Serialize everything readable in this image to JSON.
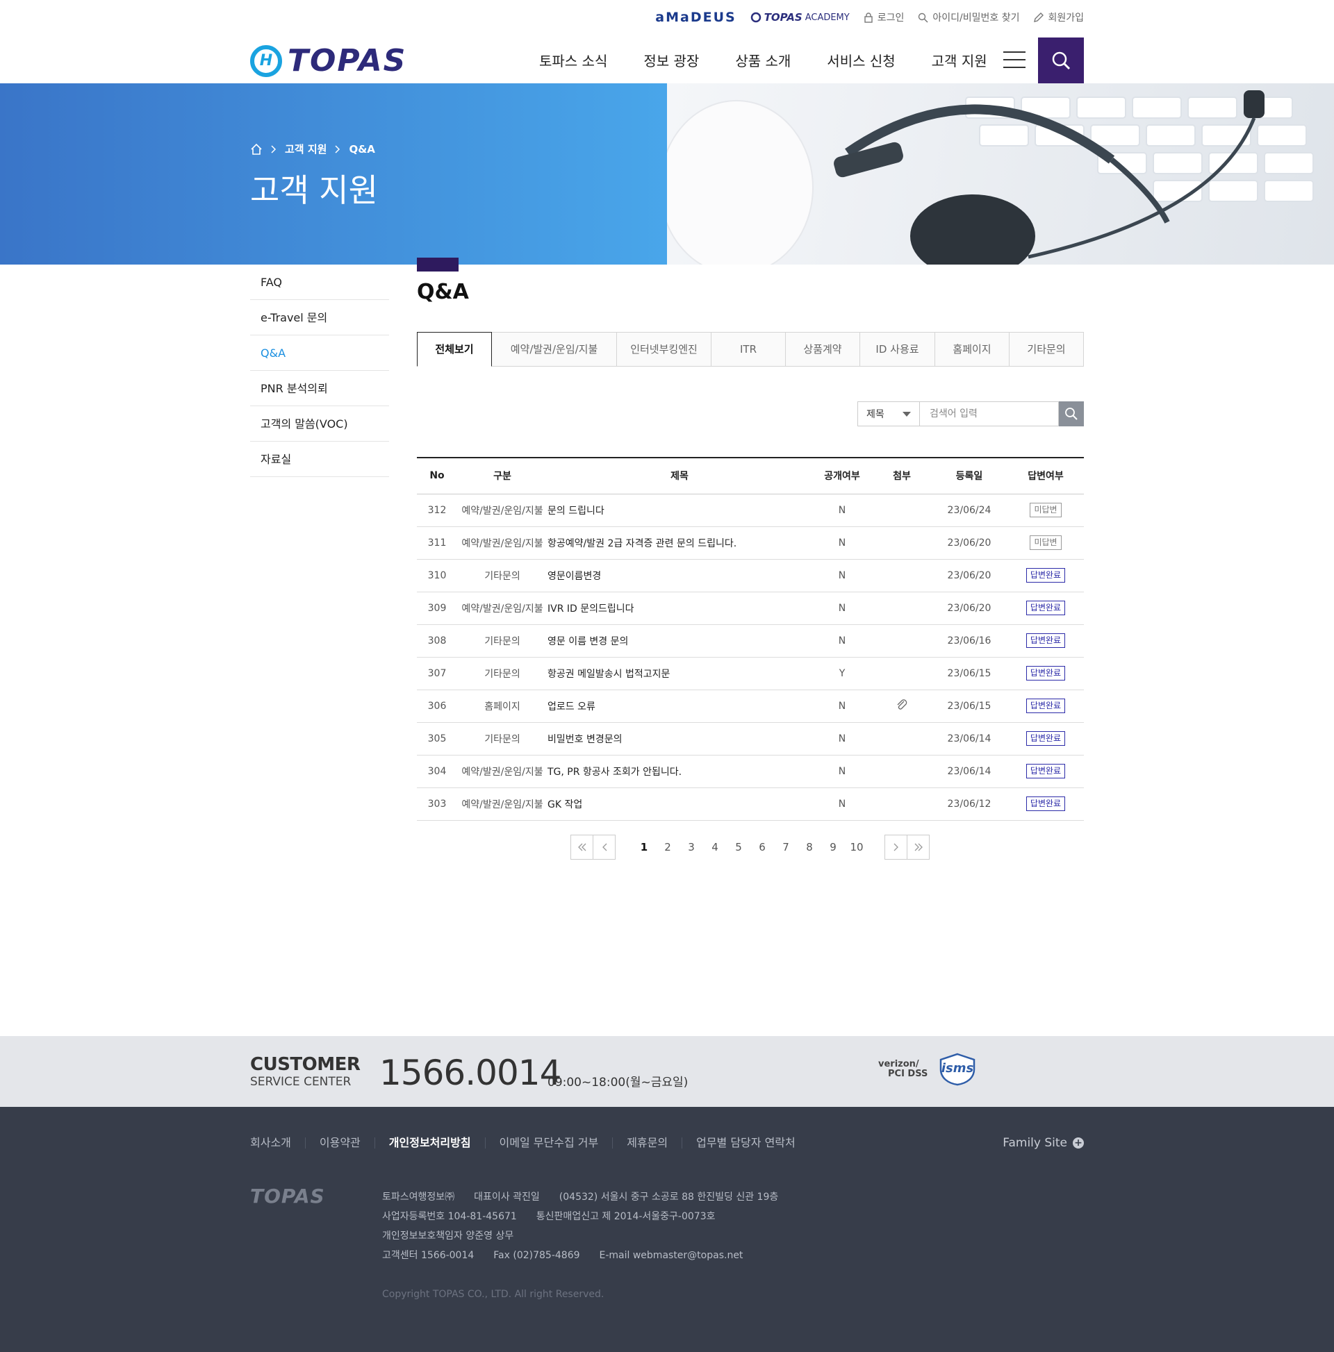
{
  "util": {
    "amadeus": "aMaDEUS",
    "academy_topas": "TOPAS",
    "academy_label": "ACADEMY",
    "login": "로그인",
    "find": "아이디/비밀번호 찾기",
    "join": "회원가입"
  },
  "logo": {
    "mark": "H",
    "word": "TOPAS"
  },
  "gnb": [
    "토파스 소식",
    "정보 광장",
    "상품 소개",
    "서비스 신청",
    "고객 지원"
  ],
  "hero": {
    "crumb1": "고객 지원",
    "crumb2": "Q&A",
    "title": "고객 지원",
    "left_color": "#3a75c8",
    "right_color": "#49a6ea"
  },
  "lnb": [
    "FAQ",
    "e-Travel 문의",
    "Q&A",
    "PNR 분석의뢰",
    "고객의 말씀(VOC)",
    "자료실"
  ],
  "lnb_active": 2,
  "page_title": "Q&A",
  "tabs": [
    "전체보기",
    "예약/발권/운임/지불",
    "인터넷부킹엔진",
    "ITR",
    "상품계약",
    "ID 사용료",
    "홈페이지",
    "기타문의"
  ],
  "search": {
    "field": "제목",
    "placeholder": "검색어 입력"
  },
  "table": {
    "headers": [
      "No",
      "구분",
      "제목",
      "공개여부",
      "첨부",
      "등록일",
      "답변여부"
    ],
    "rows": [
      {
        "no": "312",
        "cat": "예약/발권/운임/지불",
        "subj": "문의 드립니다",
        "open": "N",
        "att": false,
        "date": "23/06/24",
        "status": "미답변",
        "done": false
      },
      {
        "no": "311",
        "cat": "예약/발권/운임/지불",
        "subj": "항공예약/발권 2급 자격증 관련 문의 드립니다.",
        "open": "N",
        "att": false,
        "date": "23/06/20",
        "status": "미답변",
        "done": false
      },
      {
        "no": "310",
        "cat": "기타문의",
        "subj": "영문이름변경",
        "open": "N",
        "att": false,
        "date": "23/06/20",
        "status": "답변완료",
        "done": true
      },
      {
        "no": "309",
        "cat": "예약/발권/운임/지불",
        "subj": "IVR ID 문의드립니다",
        "open": "N",
        "att": false,
        "date": "23/06/20",
        "status": "답변완료",
        "done": true
      },
      {
        "no": "308",
        "cat": "기타문의",
        "subj": "영문 이름 변경 문의",
        "open": "N",
        "att": false,
        "date": "23/06/16",
        "status": "답변완료",
        "done": true
      },
      {
        "no": "307",
        "cat": "기타문의",
        "subj": "항공권 메일발송시 법적고지문",
        "open": "Y",
        "att": false,
        "date": "23/06/15",
        "status": "답변완료",
        "done": true
      },
      {
        "no": "306",
        "cat": "홈페이지",
        "subj": "업로드 오류",
        "open": "N",
        "att": true,
        "date": "23/06/15",
        "status": "답변완료",
        "done": true
      },
      {
        "no": "305",
        "cat": "기타문의",
        "subj": "비밀번호 변경문의",
        "open": "N",
        "att": false,
        "date": "23/06/14",
        "status": "답변완료",
        "done": true
      },
      {
        "no": "304",
        "cat": "예약/발권/운임/지불",
        "subj": "TG, PR 항공사 조회가 안됩니다.",
        "open": "N",
        "att": false,
        "date": "23/06/14",
        "status": "답변완료",
        "done": true
      },
      {
        "no": "303",
        "cat": "예약/발권/운임/지불",
        "subj": "GK 작업",
        "open": "N",
        "att": false,
        "date": "23/06/12",
        "status": "답변완료",
        "done": true
      }
    ]
  },
  "paging": {
    "pages": [
      "1",
      "2",
      "3",
      "4",
      "5",
      "6",
      "7",
      "8",
      "9",
      "10"
    ],
    "current": "1"
  },
  "cs": {
    "label1": "CUSTOMER",
    "label2": "SERVICE CENTER",
    "tel": "1566.0014",
    "hours": "09:00~18:00(월~금요일)",
    "cert1a": "verizon/",
    "cert1b": "PCI DSS",
    "cert2": "isms"
  },
  "footer": {
    "links": [
      "회사소개",
      "이용약관",
      "개인정보처리방침",
      "이메일 무단수집 거부",
      "제휴문의",
      "업무별 담당자 연락처"
    ],
    "highlight": 2,
    "family": "Family Site",
    "logo": "TOPAS",
    "info": [
      [
        "토파스여행정보㈜",
        "대표이사 곽진일",
        "(04532) 서울시 중구 소공로 88 한진빌딩 신관 19층"
      ],
      [
        "사업자등록번호 104-81-45671",
        "통신판매업신고 제 2014-서울중구-0073호"
      ],
      [
        "개인정보보호책임자 양준영 상무"
      ],
      [
        "고객센터 1566-0014",
        "Fax (02)785-4869",
        "E-mail webmaster@topas.net"
      ]
    ],
    "copyright": "Copyright TOPAS CO., LTD. All right Reserved."
  }
}
